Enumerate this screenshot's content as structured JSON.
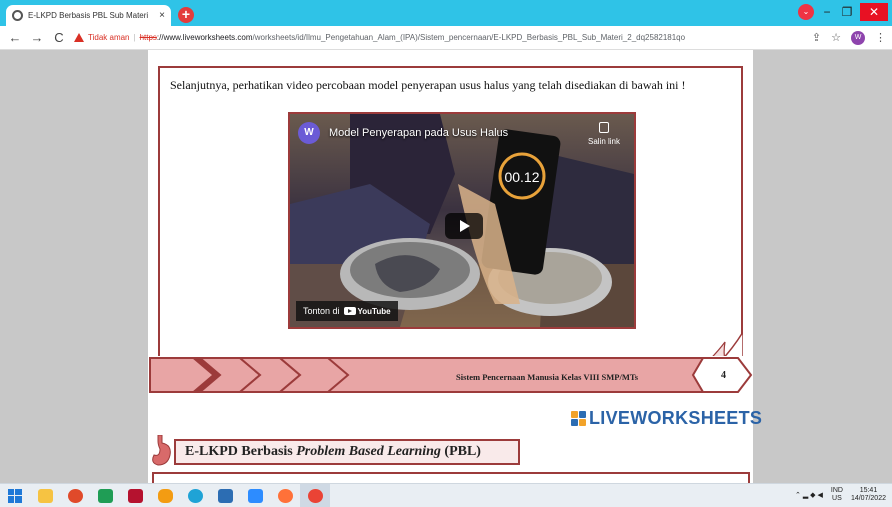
{
  "browser": {
    "tab_title": "E-LKPD Berbasis PBL Sub Materi",
    "tab_close": "×",
    "new_tab": "+",
    "security_label": "Tidak aman",
    "url_scheme": "https",
    "url_domain": "://www.liveworksheets.com",
    "url_path": "/worksheets/id/Ilmu_Pengetahuan_Alam_(IPA)/Sistem_pencernaan/E-LKPD_Berbasis_PBL_Sub_Materi_2_dq2582181qo",
    "profile_initial": "W",
    "tab_search_glyph": "⌄",
    "minimize_glyph": "−",
    "maximize_glyph": "❐",
    "close_glyph": "✕",
    "back_glyph": "←",
    "forward_glyph": "→",
    "reload_glyph": "C",
    "share_glyph": "⇪",
    "star_glyph": "☆",
    "menu_glyph": "⋮"
  },
  "page": {
    "instruction": "Selanjutnya, perhatikan video percobaan model penyerapan usus halus yang telah disediakan di bawah ini !",
    "video": {
      "channel_initial": "W",
      "title": "Model Penyerapan pada Usus Halus",
      "copy_link_label": "Salin link",
      "watch_on": "Tonton di",
      "youtube_label": "YouTube",
      "stopwatch_value": "00.12"
    },
    "footer_text": "Sistem Pencernaan Manusia Kelas VIII SMP/MTs",
    "page_number": "4",
    "logo_text": "LIVEWORKSHEETS",
    "next_header_prefix": "E-LKPD Berbasis ",
    "next_header_italic": "Problem Based Learning",
    "next_header_suffix": " (PBL)"
  },
  "taskbar": {
    "language_line1": "IND",
    "language_line2": "US",
    "time": "15:41",
    "date": "14/07/2022",
    "tray_glyphs": "⌃ ▂ ◆ ◀"
  },
  "colors": {
    "tabbar": "#2fc3e7",
    "accent_red": "#9c3b3b",
    "band_pink": "#e8a5a5",
    "logo_blue": "#2b63a7",
    "logo_orange": "#f2a32a"
  },
  "icons": [
    "globe-icon",
    "warning-icon",
    "copy-icon",
    "play-icon",
    "youtube-icon",
    "liveworksheets-logo-icon",
    "windows-start-icon"
  ]
}
